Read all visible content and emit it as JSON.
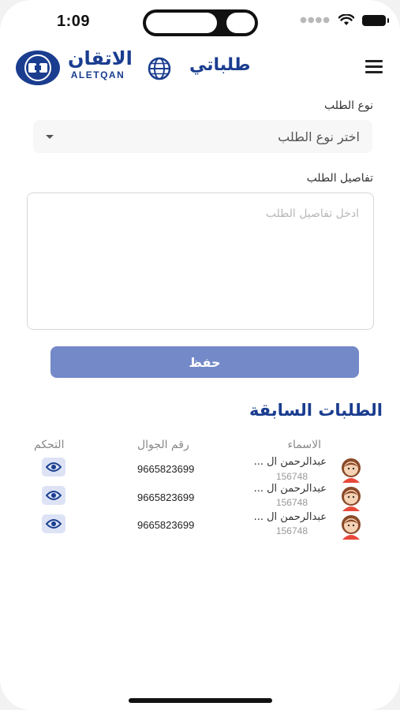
{
  "status": {
    "time": "1:09"
  },
  "header": {
    "title": "طلباتي",
    "logo_arabic": "الاتقان",
    "logo_english": "ALETQAN",
    "globe_icon": "globe-icon",
    "menu_icon": "hamburger-menu-icon"
  },
  "form": {
    "type_label": "نوع الطلب",
    "type_placeholder": "اختر نوع الطلب",
    "details_label": "تفاصيل الطلب",
    "details_placeholder": "ادخل تفاصيل الطلب",
    "save_label": "حفظ"
  },
  "previous": {
    "title": "الطلبات السابقة",
    "headers": {
      "names": "الاسماء",
      "mobile": "رقم الجوال",
      "control": "التحكم"
    },
    "rows": [
      {
        "name": "عبدالرحمن ال ...",
        "id": "156748",
        "mobile": "9665823699"
      },
      {
        "name": "عبدالرحمن ال ...",
        "id": "156748",
        "mobile": "9665823699"
      },
      {
        "name": "عبدالرحمن ال ...",
        "id": "156748",
        "mobile": "9665823699"
      }
    ]
  },
  "colors": {
    "brand": "#1a3d8f",
    "button": "#7489c8",
    "eye_bg": "#dde3f5"
  }
}
